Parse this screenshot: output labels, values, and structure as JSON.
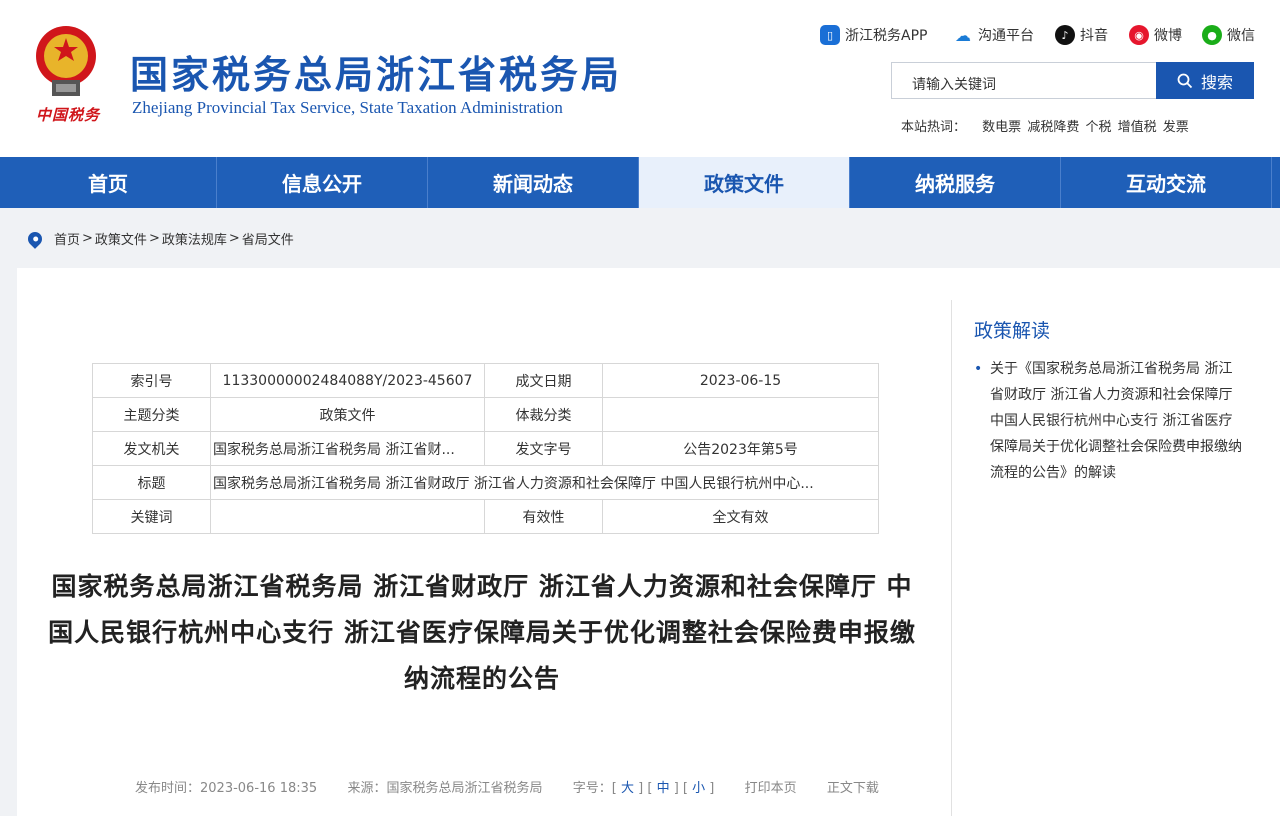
{
  "header": {
    "emblem_text": "中国税务",
    "title": "国家税务总局浙江省税务局",
    "subtitle": "Zhejiang Provincial Tax Service, State Taxation Administration",
    "social": [
      {
        "label": "浙江税务APP",
        "icon": "phone-app-icon",
        "color": "#1a6fd6"
      },
      {
        "label": "沟通平台",
        "icon": "cloud-icon",
        "color": "#1a7bd6"
      },
      {
        "label": "抖音",
        "icon": "douyin-icon",
        "color": "#111111"
      },
      {
        "label": "微博",
        "icon": "weibo-icon",
        "color": "#e6162d"
      },
      {
        "label": "微信",
        "icon": "wechat-icon",
        "color": "#1aad19"
      }
    ],
    "search_placeholder": "请输入关键词",
    "search_button": "搜索",
    "hotwords_label": "本站热词：",
    "hotwords": [
      "数电票",
      "减税降费",
      "个税",
      "增值税",
      "发票"
    ]
  },
  "nav": [
    {
      "label": "首页",
      "active": false
    },
    {
      "label": "信息公开",
      "active": false
    },
    {
      "label": "新闻动态",
      "active": false
    },
    {
      "label": "政策文件",
      "active": true
    },
    {
      "label": "纳税服务",
      "active": false
    },
    {
      "label": "互动交流",
      "active": false
    }
  ],
  "breadcrumb": [
    "首页",
    "政策文件",
    "政策法规库",
    "省局文件"
  ],
  "meta_table": {
    "index_label": "索引号",
    "index_value": "11330000002484088Y/2023-45607",
    "date_label": "成文日期",
    "date_value": "2023-06-15",
    "category_label": "主题分类",
    "category_value": "政策文件",
    "genre_label": "体裁分类",
    "genre_value": "",
    "issuer_label": "发文机关",
    "issuer_value": "国家税务总局浙江省税务局 浙江省财...",
    "docno_label": "发文字号",
    "docno_value": "公告2023年第5号",
    "title_label": "标题",
    "title_value": "国家税务总局浙江省税务局 浙江省财政厅 浙江省人力资源和社会保障厅 中国人民银行杭州中心...",
    "keyword_label": "关键词",
    "keyword_value": "",
    "validity_label": "有效性",
    "validity_value": "全文有效"
  },
  "document": {
    "title": "国家税务总局浙江省税务局 浙江省财政厅 浙江省人力资源和社会保障厅 中国人民银行杭州中心支行 浙江省医疗保障局关于优化调整社会保险费申报缴纳流程的公告",
    "publish_label": "发布时间：",
    "publish_time": "2023-06-16  18:35",
    "source_label": "来源：",
    "source": "国家税务总局浙江省税务局",
    "fontsize_label": "字号：",
    "font_large": "大",
    "font_medium": "中",
    "font_small": "小",
    "print_label": "打印本页",
    "download_label": "正文下载"
  },
  "sidebar": {
    "title": "政策解读",
    "items": [
      "关于《国家税务总局浙江省税务局 浙江省财政厅 浙江省人力资源和社会保障厅 中国人民银行杭州中心支行 浙江省医疗保障局关于优化调整社会保险费申报缴纳流程的公告》的解读"
    ]
  }
}
